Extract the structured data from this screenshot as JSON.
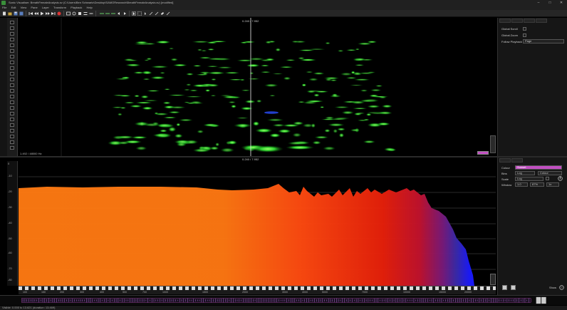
{
  "window": {
    "title": "Sonic Visualiser: BreathFemaleAnalysis.sv (C:\\Users\\Ben Schwartz\\Desktop\\SAMOResearch\\BreathFemaleAnalysis.sv) [modified]",
    "minimize": "–",
    "maximize": "□",
    "close": "✕"
  },
  "menu": [
    "File",
    "Edit",
    "View",
    "Pane",
    "Layer",
    "Transform",
    "Playback",
    "Help"
  ],
  "spectrogram": {
    "cursor_label": "0.240 / 7.952",
    "readout": "1.492 / 48000 Hz"
  },
  "spectrum": {
    "cursor_label": "0.240 / 7.952",
    "levels": [
      "0",
      "-10",
      "-20",
      "-30",
      "-40",
      "-50",
      "-60",
      "-70",
      "-80",
      "-90"
    ],
    "freq_labels": [
      "100",
      "150",
      "200",
      "300",
      "400",
      "500",
      "700",
      "1000",
      "1500",
      "2000",
      "3000",
      "4000",
      "5000",
      "7000",
      "10000",
      "15000",
      "20000"
    ]
  },
  "panel1": {
    "global_scroll": "Global Scroll",
    "global_zoom": "Global Zoom",
    "follow_playback": "Follow Playback",
    "follow_value": "Page"
  },
  "panel2": {
    "colour_label": "Colour",
    "colour_value": "Sunset",
    "bins_label": "Bins",
    "bins_value": "Log",
    "bins_value2": "Colour",
    "scale_label": "Scale",
    "scale_value": "Log",
    "window_label": "Window",
    "window_value": "1.0",
    "window_value2": "87%",
    "window_value3": "1x",
    "show_label": "Show"
  },
  "status": {
    "text": "Visible: 0.000 to 13.621 (duration: 13.469)"
  },
  "colors": {
    "accent_purple": "#c24fc2",
    "green_spec": "#3df23d"
  }
}
